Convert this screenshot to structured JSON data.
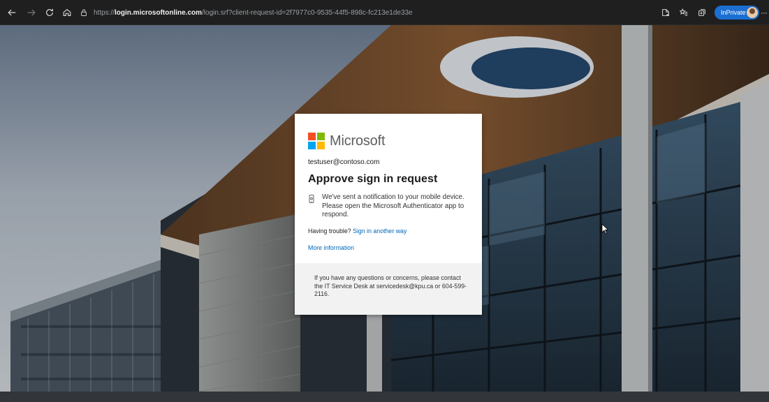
{
  "browser": {
    "url_scheme": "https://",
    "url_host": "login.microsoftonline.com",
    "url_path": "/login.srf?client-request-id=2f7977c0-9535-44f5-898c-fc213e1de33e",
    "inprivate_label": "InPrivate",
    "more_label": "···",
    "icons": [
      "back-arrow-icon",
      "forward-arrow-icon",
      "refresh-icon",
      "home-icon",
      "lock-icon",
      "reading-view-icon",
      "favorites-icon",
      "collections-icon",
      "avatar-icon"
    ],
    "accent_color": "#1b6fd1"
  },
  "card": {
    "brand": "Microsoft",
    "brand_colors": [
      "#f25022",
      "#7fba00",
      "#00a4ef",
      "#ffb900"
    ],
    "identity": "testuser@contoso.com",
    "title": "Approve sign in request",
    "notice": "We've sent a notification to your mobile device. Please open the Microsoft Authenticator app to respond.",
    "trouble_prefix": "Having trouble?",
    "trouble_link": "Sign in another way",
    "more_info_link": "More information",
    "footer_text": "If you have any questions or concerns, please contact the IT Service Desk at servicedesk@kpu.ca or 604-599-2116.",
    "link_color": "#0067b8"
  }
}
